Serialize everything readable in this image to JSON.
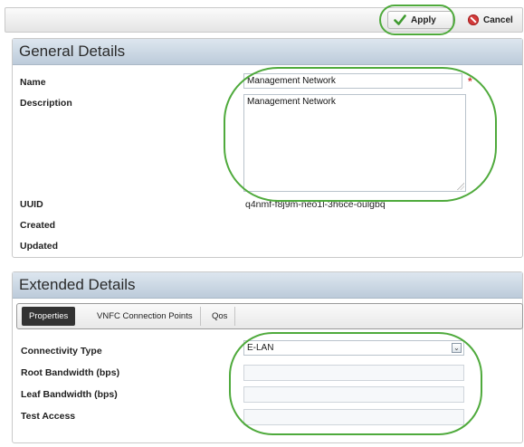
{
  "toolbar": {
    "apply_label": "Apply",
    "cancel_label": "Cancel"
  },
  "general": {
    "title": "General Details",
    "name_label": "Name",
    "name_value": "Management Network",
    "description_label": "Description",
    "description_value": "Management Network",
    "uuid_label": "UUID",
    "uuid_value": "q4nmf-f8j9m-neo1l-3h6ce-oulgbq",
    "created_label": "Created",
    "updated_label": "Updated"
  },
  "extended": {
    "title": "Extended Details",
    "tabs": [
      "Properties",
      "VNFC Connection Points",
      "Qos"
    ],
    "connectivity_label": "Connectivity Type",
    "connectivity_value": "E-LAN",
    "root_bw_label": "Root Bandwidth (bps)",
    "leaf_bw_label": "Leaf Bandwidth (bps)",
    "test_access_label": "Test Access"
  },
  "colors": {
    "highlight": "#4faa3c",
    "header": "#c8d5e2",
    "cancel": "#d33b3b",
    "check": "#3f9a2f"
  }
}
